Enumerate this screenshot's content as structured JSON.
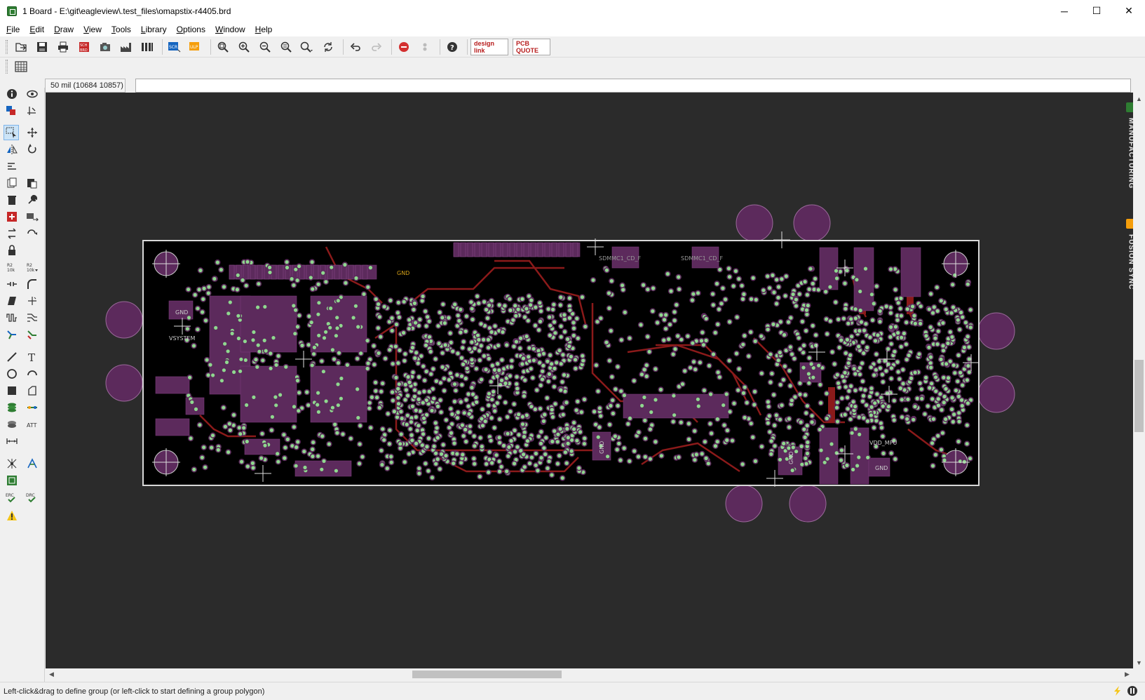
{
  "window": {
    "title": "1 Board - E:\\git\\eagleview\\.test_files\\omapstix-r4405.brd",
    "minimize": "─",
    "maximize": "☐",
    "close": "✕"
  },
  "menu": [
    "File",
    "Edit",
    "Draw",
    "View",
    "Tools",
    "Library",
    "Options",
    "Window",
    "Help"
  ],
  "toolbar": {
    "icons": [
      "open-icon",
      "save-icon",
      "print-icon",
      "sch-brd-icon",
      "cam-icon",
      "factory-icon",
      "layers-icon",
      "script-icon",
      "ulp-icon",
      "zoom-fit-icon",
      "zoom-in-icon",
      "zoom-out-icon",
      "zoom-redraw-icon",
      "zoom-select-icon",
      "refresh-icon",
      "undo-icon",
      "redo-icon",
      "stop-icon",
      "go-icon",
      "help-icon"
    ],
    "designlink_label": "design link",
    "pcbquote_label": "PCB QUOTE"
  },
  "coords": {
    "readout": "50 mil (10684 10857)",
    "command_value": ""
  },
  "board_labels": {
    "gnd_top": "GND",
    "gnd_left": "GND",
    "vsystem": "VSYSTEM",
    "sdmmc1_a": "SDMMC1_CD_F",
    "sdmmc1_b": "SDMMC1_CD_F",
    "gnd_center": "GND",
    "gnd_bottom_right": "GND",
    "gnd_right": "GND",
    "vdd_mpu": "VDD_MPU"
  },
  "side_panel": {
    "manufacturing": "MANUFACTURING",
    "fusion_sync": "FUSION SYNC"
  },
  "status": {
    "message": "Left-click&drag to define group (or left-click to start defining a group polygon)"
  },
  "colors": {
    "canvas": "#2b2b2b",
    "board": "#000000",
    "pad": "#5c2a5c",
    "via": "#8fd88f",
    "trace": "#8b1a1a",
    "outline": "#d8d8d8"
  }
}
